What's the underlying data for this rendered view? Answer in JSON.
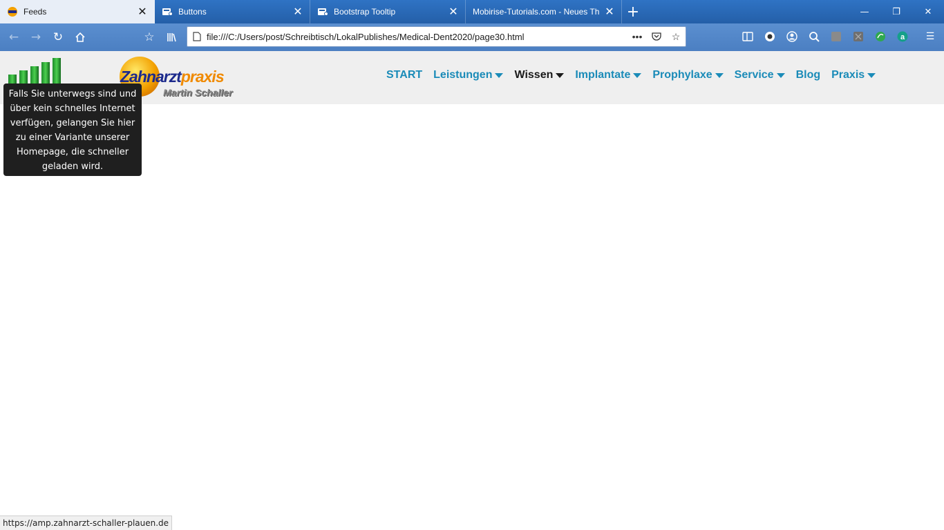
{
  "browser": {
    "tabs": [
      {
        "title": "Feeds",
        "favicon": "zahnarzt-favicon",
        "active": true
      },
      {
        "title": "Buttons",
        "favicon": "mobirise-favicon",
        "active": false
      },
      {
        "title": "Bootstrap Tooltip",
        "favicon": "mobirise-favicon",
        "active": false
      },
      {
        "title": "Mobirise-Tutorials.com - Neues Th",
        "favicon": "none",
        "active": false
      }
    ],
    "new_tab_label": "+",
    "window_controls": {
      "minimize": "—",
      "restore": "❐",
      "close": "✕"
    },
    "url": "file:///C:/Users/post/Schreibtisch/LokalPublishes/Medical-Dent2020/page30.html",
    "accent_color": "#2f73c4"
  },
  "site": {
    "logo_word_a": "Zahnarzt",
    "logo_word_b": "praxis",
    "logo_subtitle": "Martin Schaller",
    "menu": [
      {
        "label": "START",
        "dropdown": false,
        "current": false
      },
      {
        "label": "Leistungen",
        "dropdown": true,
        "current": false
      },
      {
        "label": "Wissen",
        "dropdown": true,
        "current": true
      },
      {
        "label": "Implantate",
        "dropdown": true,
        "current": false
      },
      {
        "label": "Prophylaxe",
        "dropdown": true,
        "current": false
      },
      {
        "label": "Service",
        "dropdown": true,
        "current": false
      },
      {
        "label": "Blog",
        "dropdown": false,
        "current": false
      },
      {
        "label": "Praxis",
        "dropdown": true,
        "current": false
      }
    ],
    "menu_color": "#1a8bb8",
    "tooltip": "Falls Sie unterwegs sind und über kein schnelles Internet verfügen, gelangen Sie hier zu einer Variante unserer Homepage, die schneller geladen wird."
  },
  "status_bar": "https://amp.zahnarzt-schaller-plauen.de"
}
